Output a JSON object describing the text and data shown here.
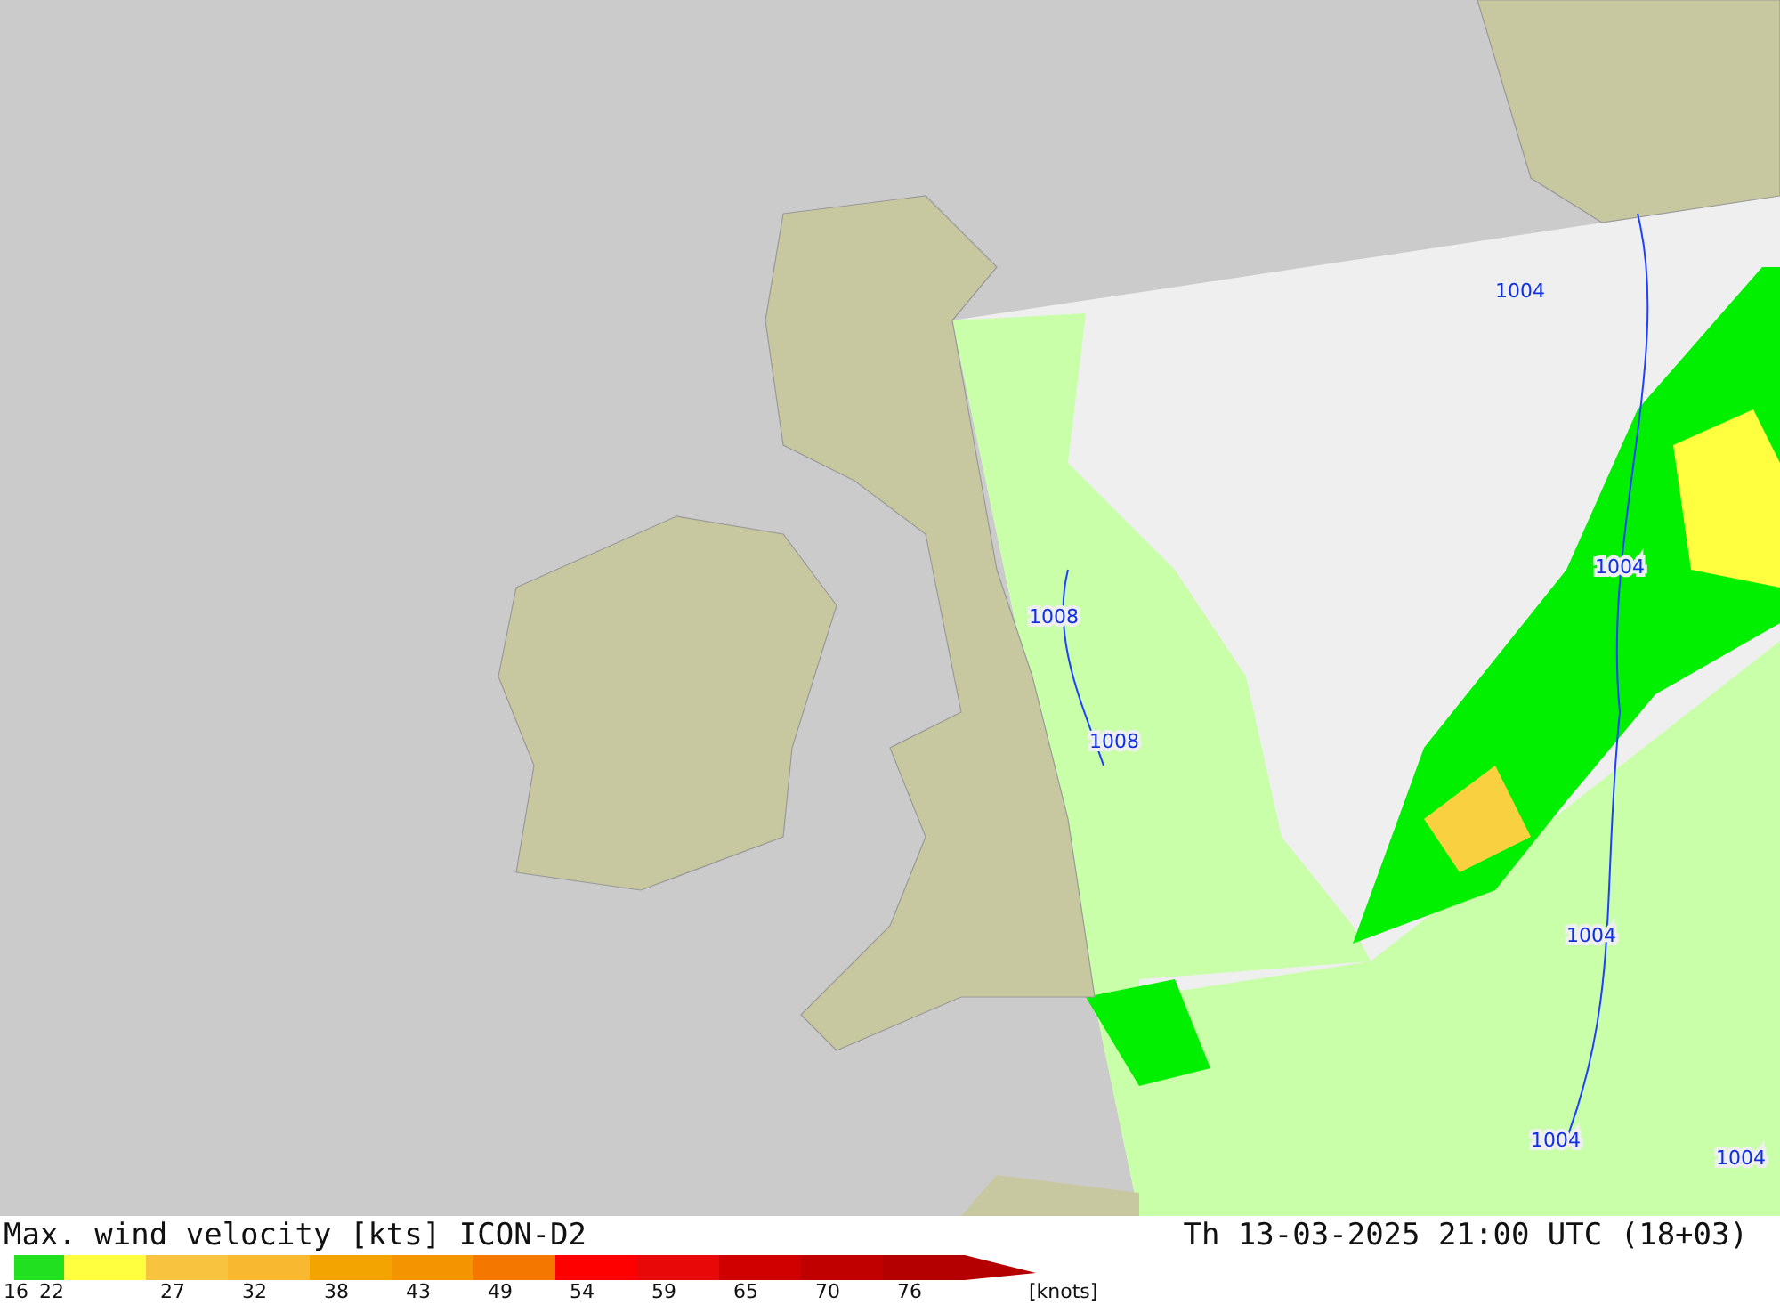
{
  "map": {
    "isobar_labels": [
      "1004",
      "1004",
      "1004",
      "1004",
      "1004",
      "1008",
      "1008"
    ]
  },
  "title": "Max. wind velocity [kts] ICON-D2",
  "valid_time": "Th 13-03-2025 21:00 UTC (18+03)",
  "legend": {
    "segments": [
      {
        "color": "#20e020"
      },
      {
        "color": "#ffff40"
      },
      {
        "color": "#f8c440"
      },
      {
        "color": "#f8b830"
      },
      {
        "color": "#f4a400"
      },
      {
        "color": "#f49400"
      },
      {
        "color": "#f47800"
      },
      {
        "color": "#ff0000"
      },
      {
        "color": "#e80808"
      },
      {
        "color": "#d00000"
      },
      {
        "color": "#c00000"
      },
      {
        "color": "#b40000"
      }
    ],
    "labels": [
      "16",
      "22",
      "27",
      "32",
      "38",
      "43",
      "49",
      "54",
      "59",
      "65",
      "70",
      "76"
    ],
    "unit": "[knots]"
  }
}
